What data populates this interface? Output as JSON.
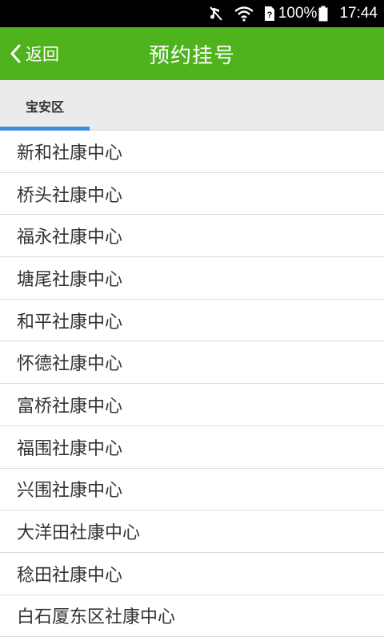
{
  "status_bar": {
    "battery_text": "100%",
    "time": "17:44",
    "icons": [
      "mute-icon",
      "wifi-icon",
      "sim-unknown-icon",
      "battery-icon"
    ]
  },
  "header": {
    "back_label": "返回",
    "title": "预约挂号",
    "color": "#4fb31d"
  },
  "tabs": [
    {
      "label": "宝安区",
      "active": true
    }
  ],
  "accent": "#3b8fd9",
  "clinics": [
    "新和社康中心",
    "桥头社康中心",
    "福永社康中心",
    "塘尾社康中心",
    "和平社康中心",
    "怀德社康中心",
    "富桥社康中心",
    "福围社康中心",
    "兴围社康中心",
    "大洋田社康中心",
    "稔田社康中心",
    "白石厦东区社康中心"
  ]
}
